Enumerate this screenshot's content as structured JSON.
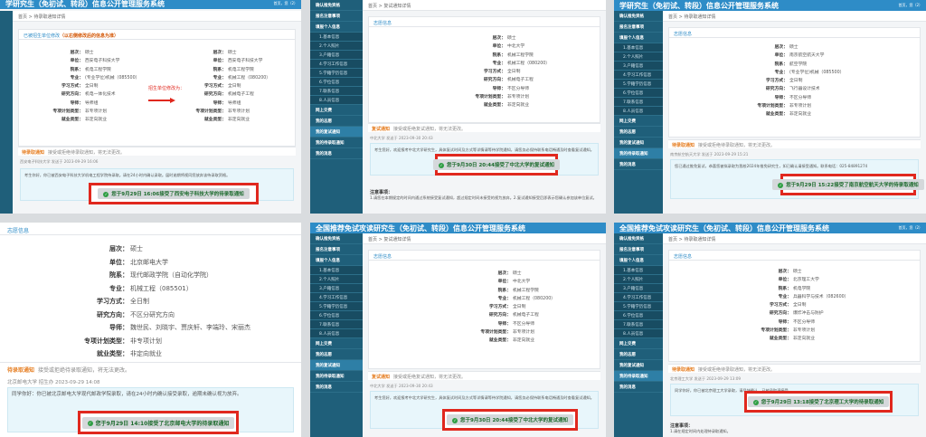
{
  "system_title": "全国推荐免试攻读研究生（免初试、转段）信息公开管理服务系统",
  "system_title_short": "学研究生（免初试、转段）信息公开管理服务系统",
  "user_bar": "首页，您（2）",
  "breadcrumb_admit": "首页 > 待录取通知详情",
  "breadcrumb_retest": "首页 > 复试通知详情",
  "sidebar": [
    {
      "label": "确认推免资格",
      "type": "h"
    },
    {
      "label": "报名注意事项",
      "type": "h"
    },
    {
      "label": "填报个人信息",
      "type": "h"
    },
    {
      "label": "1.基本信息",
      "type": "sub"
    },
    {
      "label": "2.个人照片",
      "type": "sub"
    },
    {
      "label": "3.户籍信息",
      "type": "sub"
    },
    {
      "label": "4.学习工作信息",
      "type": "sub"
    },
    {
      "label": "5.学籍学历信息",
      "type": "sub"
    },
    {
      "label": "6.学位信息",
      "type": "sub"
    },
    {
      "label": "7.联系信息",
      "type": "sub"
    },
    {
      "label": "8.人员信息",
      "type": "sub"
    },
    {
      "label": "网上交费",
      "type": "h"
    },
    {
      "label": "我的志愿",
      "type": "h"
    },
    {
      "label": "我的复试通知",
      "type": "h"
    },
    {
      "label": "我的待录取通知",
      "type": "h"
    },
    {
      "label": "我的消息",
      "type": "h"
    }
  ],
  "labels": {
    "level": "层次：",
    "unit": "单位：",
    "dept": "院系：",
    "major": "专业：",
    "mode": "学习方式：",
    "direction": "研究方向：",
    "mentor": "导师：",
    "plan": "专项计划类型：",
    "employ": "就业类型："
  },
  "p1": {
    "card_title": "已被招生单位修改",
    "warning": "（以右侧修改后的信息为准）",
    "arrow_note": "招生单位修改为：",
    "before": {
      "level": "硕士",
      "unit": "西安电子科技大学",
      "dept": "机电工程学院",
      "major": "(专业学位)机械（085500）",
      "mode": "全日制",
      "direction": "机电一体化技术",
      "mentor": "导师组",
      "plan": "非专项计划",
      "employ": "非定向就业"
    },
    "after": {
      "level": "硕士",
      "unit": "西安电子科技大学",
      "dept": "机电工程学院",
      "major": "机械工程（080200）",
      "mode": "全日制",
      "direction": "机械电子工程",
      "mentor": "导师组",
      "plan": "非专项计划",
      "employ": "非定向就业"
    },
    "admit_title": "待录取通知",
    "admit_note": "接受或拒绝待录取通知，将无法更改。",
    "meta": "西安电子科技大学 发送于 2023-09-29 16:06",
    "notice": "考生你好，你已被西安电子科技大学机电工程学院待录取。请在24小时内确认录取。届时逾期将视同您放弃该待录取资格。",
    "accepted": "您于9月29日 16:06接受了西安电子科技大学的待录取通知"
  },
  "p2": {
    "card_title": "志愿信息",
    "fields": {
      "level": "硕士",
      "unit": "中北大学",
      "dept": "机械工程学院",
      "major": "机械工程（080200）",
      "mode": "全日制",
      "direction": "机械电子工程",
      "mentor": "不区分导师",
      "plan": "非专项计划",
      "employ": "非定向就业"
    },
    "retest_title": "复试通知",
    "retest_note": "接受或拒绝复试通知，将无法更改。",
    "meta": "中北大学 发送于 2023-09-30 20:43",
    "notice": "考生您好，欢迎报考中北大学研究生，具体复试时间及方式等详情请等待学院通知，请您务必保持联系电话畅通及时查看复试通知。",
    "accepted": "您于9月30日 20:44接受了中北大学的复试通知",
    "footnote_title": "注意事项：",
    "footnote": "1.请您在本期规定的时间内通过系统接受复试通知，超过规定时间未接受的视为放弃。2.复试通知接受后即表示您确认参加该单位复试。"
  },
  "p3": {
    "card_title": "志愿信息",
    "fields": {
      "level": "硕士",
      "unit": "南京航空航天大学",
      "dept": "航空学院",
      "major": "(专业学位)机械（085500）",
      "mode": "全日制",
      "direction": "飞行器设计技术",
      "mentor": "不区分导师",
      "plan": "非专项计划",
      "employ": "非定向就业"
    },
    "admit_title": "待录取通知",
    "admit_note": "接受或拒绝待录取通知，将无法更改。",
    "meta": "南京航空航天大学 发送于 2023-09-29 15:21",
    "notice": "您已通过推免复试，恭喜您被拟录取为我校2024年推免研究生，如已确认请接受通知。联系电话：025-84891274",
    "accepted": "您于9月29日 15:22接受了南京航空航天大学的待录取通知"
  },
  "p4": {
    "card_title": "志愿信息",
    "fields": {
      "level": "硕士",
      "unit": "北京邮电大学",
      "dept": "现代邮政学院（自动化学院）",
      "major": "机械工程（085501）",
      "mode": "全日制",
      "direction": "不区分研究方向",
      "mentor": "魏世民、刘晓宇、贾庆轩、李端玲、宋丽杰",
      "plan": "非专项计划",
      "employ": "非定向就业"
    },
    "admit_title": "待录取通知",
    "admit_note": "接受或拒绝待录取通知，将无法更改。",
    "meta": "北京邮电大学 招生办 2023-09-29 14:08",
    "notice": "同学你好：你已被北京邮电大学现代邮政学院录取，请在24小时内确认接受录取，逾期未确认视为放弃。",
    "accepted": "您于9月29日 14:10接受了北京邮电大学的待录取通知"
  },
  "p5": {
    "card_title": "志愿信息",
    "fields": {
      "level": "硕士",
      "unit": "中北大学",
      "dept": "机械工程学院",
      "major": "机械工程（080200）",
      "mode": "全日制",
      "direction": "机械电子工程",
      "mentor": "不区分导师",
      "plan": "非专项计划",
      "employ": "非定向就业"
    },
    "retest_title": "复试通知",
    "retest_note": "接受或拒绝复试通知，将无法更改。",
    "meta": "中北大学 发送于 2023-09-30 20:43",
    "notice": "考生您好，欢迎报考中北大学研究生，具体复试时间及方式等详情请等待学院通知，请您务必保持联系电话畅通及时查看复试通知。",
    "accepted": "您于9月30日 20:44接受了中北大学的复试通知"
  },
  "p6": {
    "card_title": "志愿信息",
    "fields": {
      "level": "硕士",
      "unit": "北京理工大学",
      "dept": "机电学院",
      "major": "兵器科学与技术（082600）",
      "mode": "全日制",
      "direction": "爆炸冲击与防护",
      "mentor": "不区分导师",
      "plan": "非专项计划",
      "employ": "非定向就业"
    },
    "admit_title": "待录取通知",
    "admit_note": "接受或拒绝待录取通知，将无法更改。",
    "meta": "北京理工大学 发送于 2023-09-29 13:09",
    "notice": "同学你好，你已被北京理工大学录取，请尽快确认，已被录取请接受。",
    "accepted": "您于9月29日 13:18接受了北京理工大学的待录取通知",
    "footnote_title": "注意事项：",
    "footnote": "1.请在规定时间内处理待录取通知。"
  },
  "colors": {
    "accent": "#2e8cc7",
    "highlight": "#e0281e",
    "sidebar": "#1f5f7a",
    "success": "#2f9e44"
  }
}
